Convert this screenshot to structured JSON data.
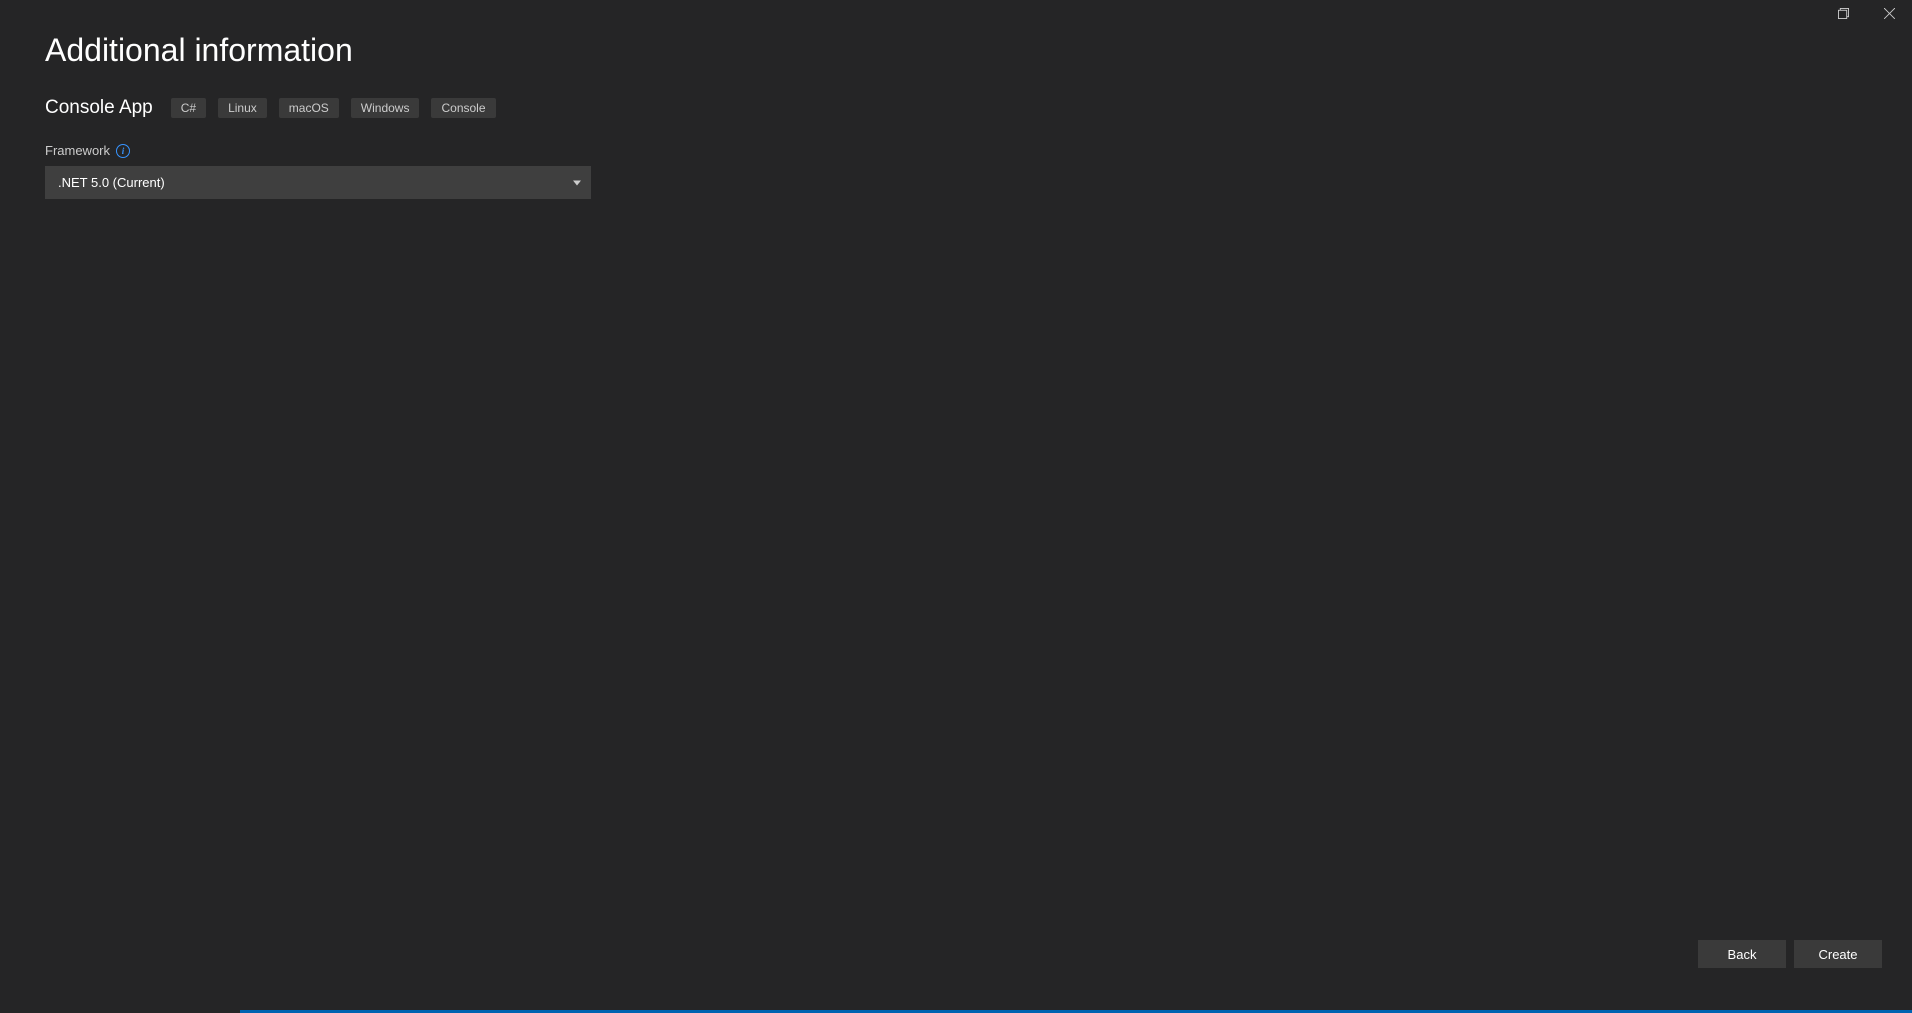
{
  "page": {
    "title": "Additional information"
  },
  "project": {
    "name": "Console App",
    "tags": [
      "C#",
      "Linux",
      "macOS",
      "Windows",
      "Console"
    ]
  },
  "framework": {
    "label": "Framework",
    "selected": ".NET 5.0 (Current)"
  },
  "footer": {
    "back_label": "Back",
    "create_label": "Create"
  }
}
